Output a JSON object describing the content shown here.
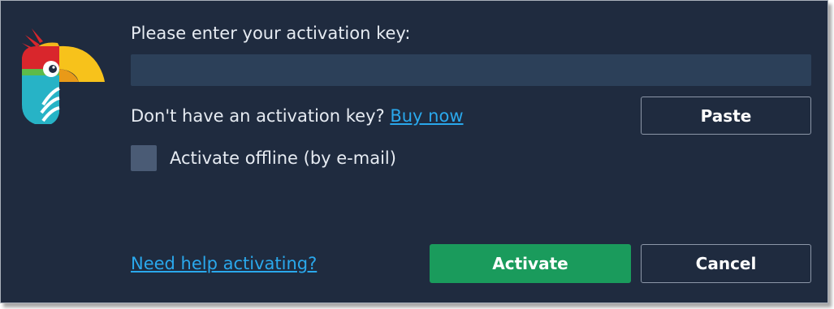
{
  "dialog": {
    "prompt": "Please enter your activation key:",
    "key_input": {
      "value": "",
      "placeholder": ""
    },
    "no_key_text": "Don't have an activation key?",
    "buy_now_link": "Buy now",
    "paste_button": "Paste",
    "offline_checkbox": {
      "label": "Activate offline (by e-mail)",
      "checked": false
    },
    "help_link": "Need help activating?",
    "activate_button": "Activate",
    "cancel_button": "Cancel"
  },
  "icons": {
    "logo": "parrot-logo-icon"
  },
  "colors": {
    "background": "#1f2b3f",
    "input_background": "#2c4059",
    "text": "#e6ebf2",
    "link": "#2aa8ec",
    "primary_button": "#1a9b5c",
    "button_border": "#8c97a8",
    "checkbox": "#4a5b75"
  }
}
